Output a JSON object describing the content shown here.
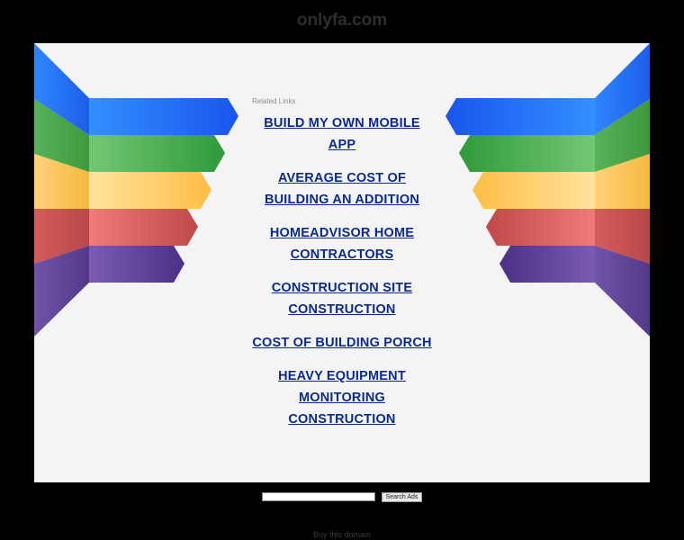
{
  "header": {
    "domain": "onlyfa.com"
  },
  "related": {
    "heading": "Related Links",
    "links": [
      {
        "label": "BUILD MY OWN MOBILE APP"
      },
      {
        "label": "AVERAGE COST OF BUILDING AN ADDITION"
      },
      {
        "label": "HOMEADVISOR HOME CONTRACTORS"
      },
      {
        "label": "CONSTRUCTION SITE CONSTRUCTION"
      },
      {
        "label": "COST OF BUILDING PORCH"
      },
      {
        "label": "HEAVY EQUIPMENT MONITORING CONSTRUCTION"
      }
    ]
  },
  "search": {
    "button_label": "Search Ads",
    "value": ""
  },
  "footer": {
    "buy_label": "Buy this domain"
  },
  "colors": {
    "background": "#000000",
    "panel": "#f4f4f4",
    "link": "#0b2a8c",
    "ribbon_blue": "#2f80ff",
    "ribbon_green": "#5cba5c",
    "ribbon_yellow": "#ffd37a",
    "ribbon_red": "#dc6464",
    "ribbon_purple": "#6a4a9a"
  }
}
